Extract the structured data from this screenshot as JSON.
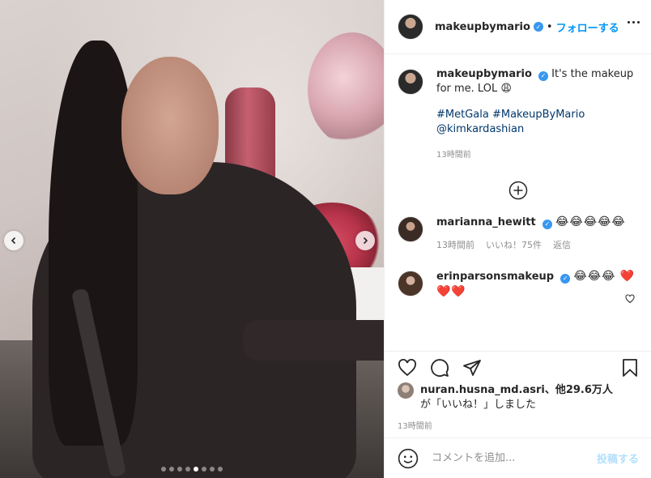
{
  "post": {
    "author": "makeupbymario",
    "separator": "•",
    "follow_label": "フォローする",
    "verified_mark": "✓"
  },
  "photo": {
    "dots_total": 8,
    "active_dot_index": 4
  },
  "caption": {
    "author": "makeupbymario",
    "text": "It's the makeup for me. LOL 😩",
    "tags": "#MetGala #MakeupByMario @kimkardashian",
    "time": "13時間前"
  },
  "comments": [
    {
      "author": "marianna_hewitt",
      "emoji": "😂😂😂😂😂",
      "time": "13時間前",
      "likes": "いいね！75件",
      "reply": "返信"
    },
    {
      "author": "erinparsonsmakeup",
      "emoji": "😂😂😂 ❤️❤️❤️"
    }
  ],
  "likes": {
    "user": "nuran.husna_md.asri",
    "suffix": "、他29.6万人",
    "line2": "が「いいね！」しました"
  },
  "date": "13時間前",
  "comment_box": {
    "placeholder": "コメントを追加...",
    "post_label": "投稿する"
  },
  "icons": {
    "prev": "chevron-left-icon",
    "next": "chevron-right-icon",
    "more": "more-options-icon",
    "load_more": "plus-circle-icon",
    "like": "heart-icon",
    "comment": "comment-icon",
    "share": "share-icon",
    "save": "bookmark-icon",
    "emoji": "emoji-icon"
  },
  "colors": {
    "accent": "#0095f6",
    "verified": "#3897f0",
    "muted": "#8e8e8e",
    "hashtag": "#00376b"
  }
}
